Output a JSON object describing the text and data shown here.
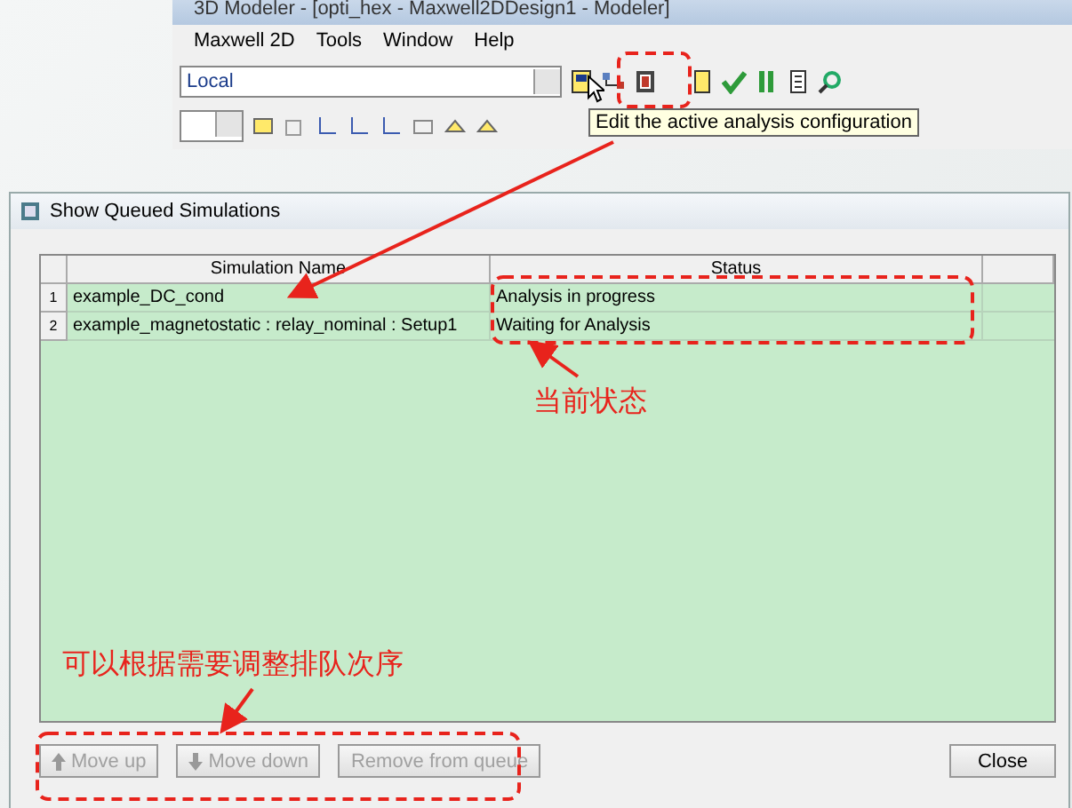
{
  "window": {
    "title": "3D Modeler - [opti_hex - Maxwell2DDesign1 - Modeler]"
  },
  "menu": [
    {
      "label": "Maxwell 2D"
    },
    {
      "label": "Tools"
    },
    {
      "label": "Window"
    },
    {
      "label": "Help"
    }
  ],
  "toolbar": {
    "combo_value": "Local",
    "tooltip": "Edit the active analysis configuration"
  },
  "dialog": {
    "title": "Show Queued Simulations",
    "columns": [
      "Simulation Name",
      "Status"
    ],
    "rows": [
      {
        "index": "1",
        "name": "example_DC_cond",
        "status": "Analysis in progress"
      },
      {
        "index": "2",
        "name": "example_magnetostatic : relay_nominal : Setup1",
        "status": "Waiting for Analysis"
      }
    ],
    "buttons": [
      {
        "label": "Move up",
        "kind": "up",
        "disabled": true
      },
      {
        "label": "Move down",
        "kind": "down",
        "disabled": true
      },
      {
        "label": "Remove from queue",
        "kind": "plain",
        "disabled": true
      },
      {
        "label": "Close",
        "kind": "plain",
        "disabled": false
      }
    ]
  },
  "annotations": [
    {
      "text": "当前状态"
    },
    {
      "text": "可以根据需要调整排队次序"
    }
  ]
}
